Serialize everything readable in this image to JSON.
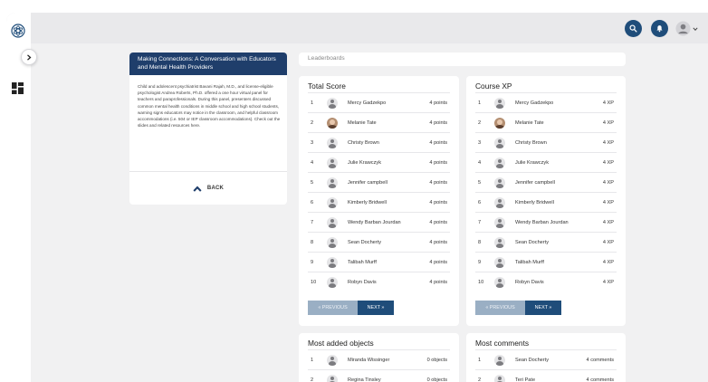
{
  "description": {
    "title": "Making Connections: A Conversation with Educators and Mental Health Providers",
    "body": "Child and adolescent psychiatrist Bavani Rajah, M.D., and license-eligible psychologist Andrea Roberts, Ph.D. offered a one hour virtual panel for teachers and paraprofessionals. During this panel, presenters discussed common mental health conditions in middle school and high school students, warning signs educators may notice in the classroom, and helpful classroom accommodations (i.e. 504 or IEP classroom accommodations). Check out the slides and related resources here.",
    "back_label": "BACK"
  },
  "leaderboards_label": "Leaderboards",
  "boards": {
    "total_score": {
      "title": "Total Score",
      "rows": [
        {
          "rank": "1",
          "name": "Mercy Gadzekpo",
          "value": "4 points",
          "avatar": "default"
        },
        {
          "rank": "2",
          "name": "Melanie Tate",
          "value": "4 points",
          "avatar": "photo"
        },
        {
          "rank": "3",
          "name": "Christy Brown",
          "value": "4 points",
          "avatar": "default"
        },
        {
          "rank": "4",
          "name": "Julie Krawczyk",
          "value": "4 points",
          "avatar": "default"
        },
        {
          "rank": "5",
          "name": "Jennifer campbell",
          "value": "4 points",
          "avatar": "default"
        },
        {
          "rank": "6",
          "name": "Kimberly Bridwell",
          "value": "4 points",
          "avatar": "default"
        },
        {
          "rank": "7",
          "name": "Wendy Barban Jourdan",
          "value": "4 points",
          "avatar": "default"
        },
        {
          "rank": "8",
          "name": "Sean Docherty",
          "value": "4 points",
          "avatar": "default"
        },
        {
          "rank": "9",
          "name": "Talibah Murff",
          "value": "4 points",
          "avatar": "default"
        },
        {
          "rank": "10",
          "name": "Robyn Davis",
          "value": "4 points",
          "avatar": "default"
        }
      ],
      "prev_label": "« PREVIOUS",
      "next_label": "NEXT »"
    },
    "course_xp": {
      "title": "Course XP",
      "rows": [
        {
          "rank": "1",
          "name": "Mercy Gadzekpo",
          "value": "4 XP",
          "avatar": "default"
        },
        {
          "rank": "2",
          "name": "Melanie Tate",
          "value": "4 XP",
          "avatar": "photo"
        },
        {
          "rank": "3",
          "name": "Christy Brown",
          "value": "4 XP",
          "avatar": "default"
        },
        {
          "rank": "4",
          "name": "Julie Krawczyk",
          "value": "4 XP",
          "avatar": "default"
        },
        {
          "rank": "5",
          "name": "Jennifer campbell",
          "value": "4 XP",
          "avatar": "default"
        },
        {
          "rank": "6",
          "name": "Kimberly Bridwell",
          "value": "4 XP",
          "avatar": "default"
        },
        {
          "rank": "7",
          "name": "Wendy Barban Jourdan",
          "value": "4 XP",
          "avatar": "default"
        },
        {
          "rank": "8",
          "name": "Sean Docherty",
          "value": "4 XP",
          "avatar": "default"
        },
        {
          "rank": "9",
          "name": "Talibah Murff",
          "value": "4 XP",
          "avatar": "default"
        },
        {
          "rank": "10",
          "name": "Robyn Davis",
          "value": "4 XP",
          "avatar": "default"
        }
      ],
      "prev_label": "« PREVIOUS",
      "next_label": "NEXT »"
    },
    "most_added": {
      "title": "Most added objects",
      "rows": [
        {
          "rank": "1",
          "name": "Miranda Wissinger",
          "value": "0 objects",
          "avatar": "default"
        },
        {
          "rank": "2",
          "name": "Regina Tinsley",
          "value": "0 objects",
          "avatar": "default"
        }
      ]
    },
    "most_comments": {
      "title": "Most comments",
      "rows": [
        {
          "rank": "1",
          "name": "Sean Docherty",
          "value": "4 comments",
          "avatar": "default"
        },
        {
          "rank": "2",
          "name": "Teri Pate",
          "value": "4 comments",
          "avatar": "default"
        }
      ]
    }
  },
  "icons": {
    "logo": "logo-icon",
    "collapse": "chevron-right-icon",
    "dashboard": "dashboard-icon",
    "search": "search-icon",
    "notifications": "bell-icon",
    "user": "user-icon",
    "dropdown": "chevron-down-icon"
  },
  "colors": {
    "primary": "#1f4d7a",
    "header_dark": "#1f3e6b",
    "disabled_button": "#9aafc4",
    "background": "#f1f1f2"
  }
}
